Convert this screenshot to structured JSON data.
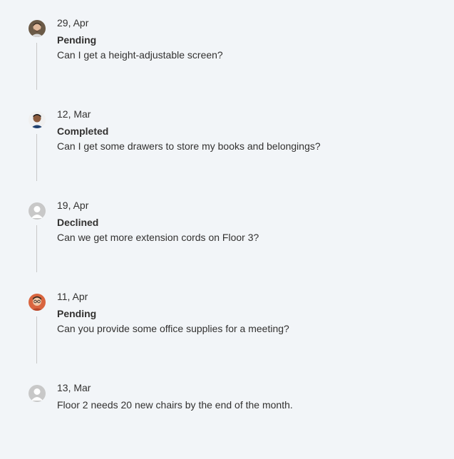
{
  "timeline": {
    "items": [
      {
        "date": "29, Apr",
        "status": "Pending",
        "message": "Can I get a height-adjustable screen?",
        "avatar": "avatar-person-beard-icon"
      },
      {
        "date": "12, Mar",
        "status": "Completed",
        "message": "Can I get some drawers to store my books and belongings?",
        "avatar": "avatar-person-dark-hair-icon"
      },
      {
        "date": "19, Apr",
        "status": "Declined",
        "message": "Can we get more extension cords on Floor 3?",
        "avatar": "avatar-placeholder-icon"
      },
      {
        "date": "11, Apr",
        "status": "Pending",
        "message": "Can you provide some office supplies for a meeting?",
        "avatar": "avatar-person-glasses-icon"
      },
      {
        "date": "13, Mar",
        "status": "",
        "message": "Floor 2 needs 20 new chairs by the end of the month.",
        "avatar": "avatar-placeholder-icon"
      }
    ]
  },
  "colors": {
    "background": "#f2f5f8",
    "text": "#323130",
    "connector": "#c8c8c8",
    "placeholder_avatar": "#c8c8c8"
  }
}
